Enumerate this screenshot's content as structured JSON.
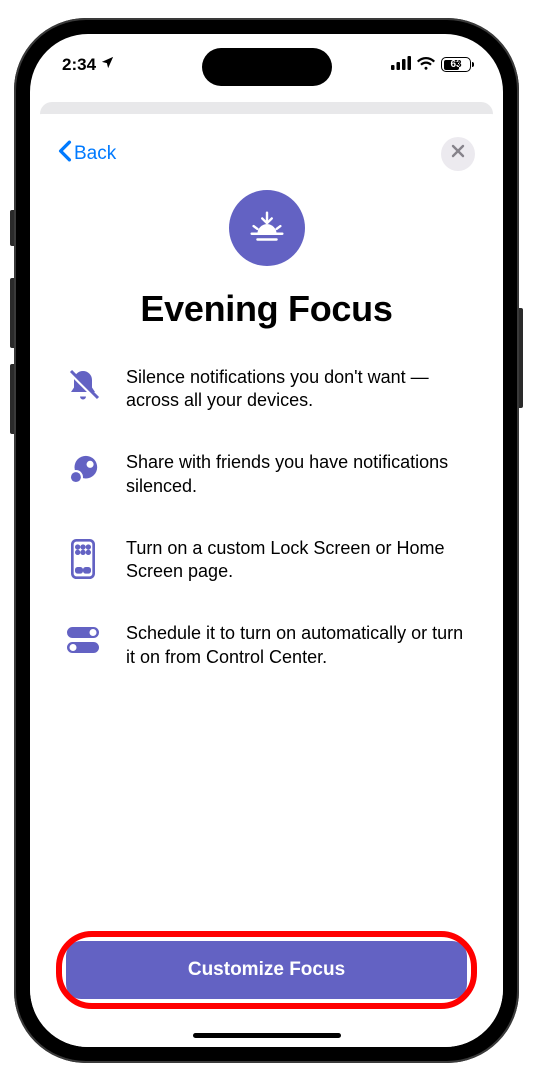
{
  "status": {
    "time": "2:34",
    "battery": "63"
  },
  "nav": {
    "back_label": "Back"
  },
  "hero": {
    "title": "Evening Focus"
  },
  "features": [
    {
      "text": "Silence notifications you don't want — across all your devices."
    },
    {
      "text": "Share with friends you have notifications silenced."
    },
    {
      "text": "Turn on a custom Lock Screen or Home Screen page."
    },
    {
      "text": "Schedule it to turn on automatically or turn it on from Control Center."
    }
  ],
  "cta": {
    "label": "Customize Focus"
  }
}
